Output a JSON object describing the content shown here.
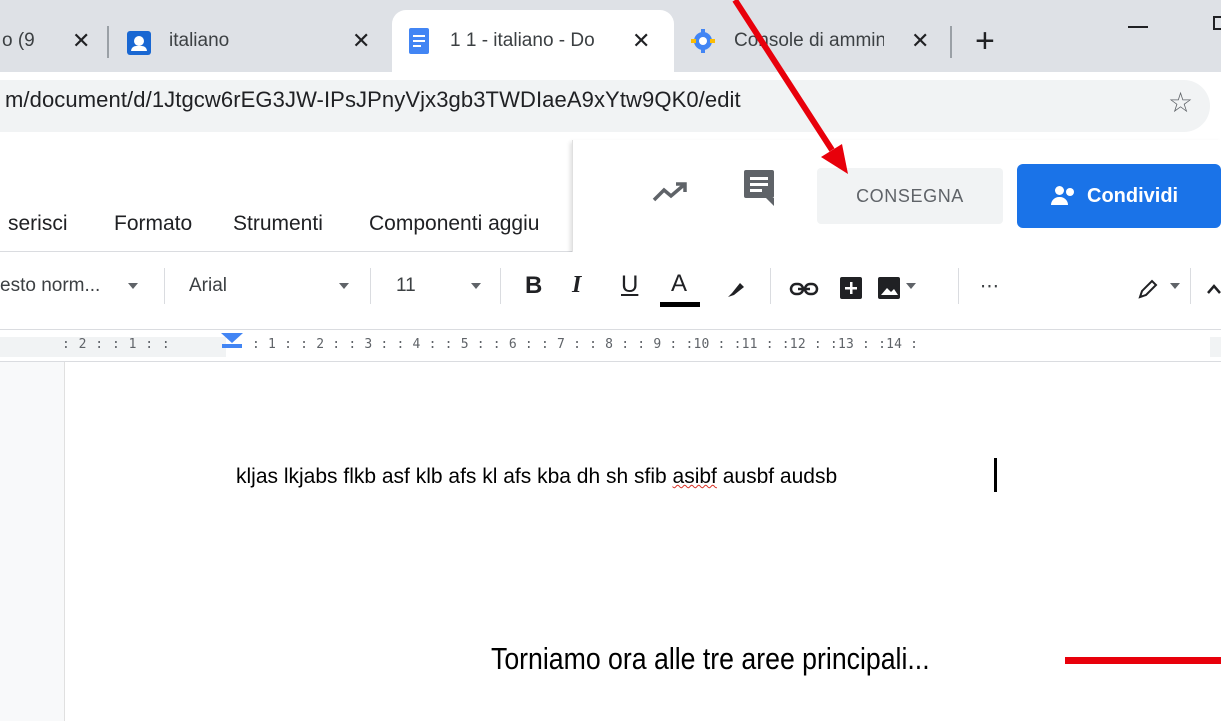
{
  "browser": {
    "tabs": [
      {
        "title": "o (9",
        "favicon": "classroom-icon",
        "active": false
      },
      {
        "title": "italiano",
        "favicon": "classroom-icon",
        "active": false
      },
      {
        "title": "1 1 - italiano - Do",
        "favicon": "docs-icon",
        "active": true
      },
      {
        "title": "Console di ammin",
        "favicon": "admin-console-icon",
        "active": false
      }
    ],
    "new_tab_label": "+",
    "url": "m/document/d/1Jtgcw6rEG3JW-IPsJPnyVjx3gb3TWDIaeA9xYtw9QK0/edit",
    "bookmark_icon": "star-icon"
  },
  "docs": {
    "menu": [
      "serisci",
      "Formato",
      "Strumenti",
      "Componenti aggiu"
    ],
    "consegna_label": "CONSEGNA",
    "share_label": "Condividi",
    "toolbar": {
      "style": "esto norm...",
      "font": "Arial",
      "size": "11",
      "bold": "B",
      "italic": "I",
      "underline": "U",
      "text_color": "A",
      "more": "⋯"
    },
    "ruler": ": 2 : : 1 : :",
    "ruler_right": ": 1 : : 2 : : 3 : : 4 : : 5 : : 6 : : 7 : : 8 : : 9 : :10 : :11 : :12 : :13 : :14 :",
    "body_text_before": "kljas lkjabs flkb asf klb afs kl afs kba dh sh sfib ",
    "body_text_misspelled": "asibf",
    "body_text_after": " ausbf audsb"
  },
  "annotation": {
    "caption": "Torniamo ora alle tre aree principali...",
    "arrow_color": "#e8000b"
  },
  "colors": {
    "accent": "#1a73e8",
    "tab_strip": "#dee1e6"
  }
}
